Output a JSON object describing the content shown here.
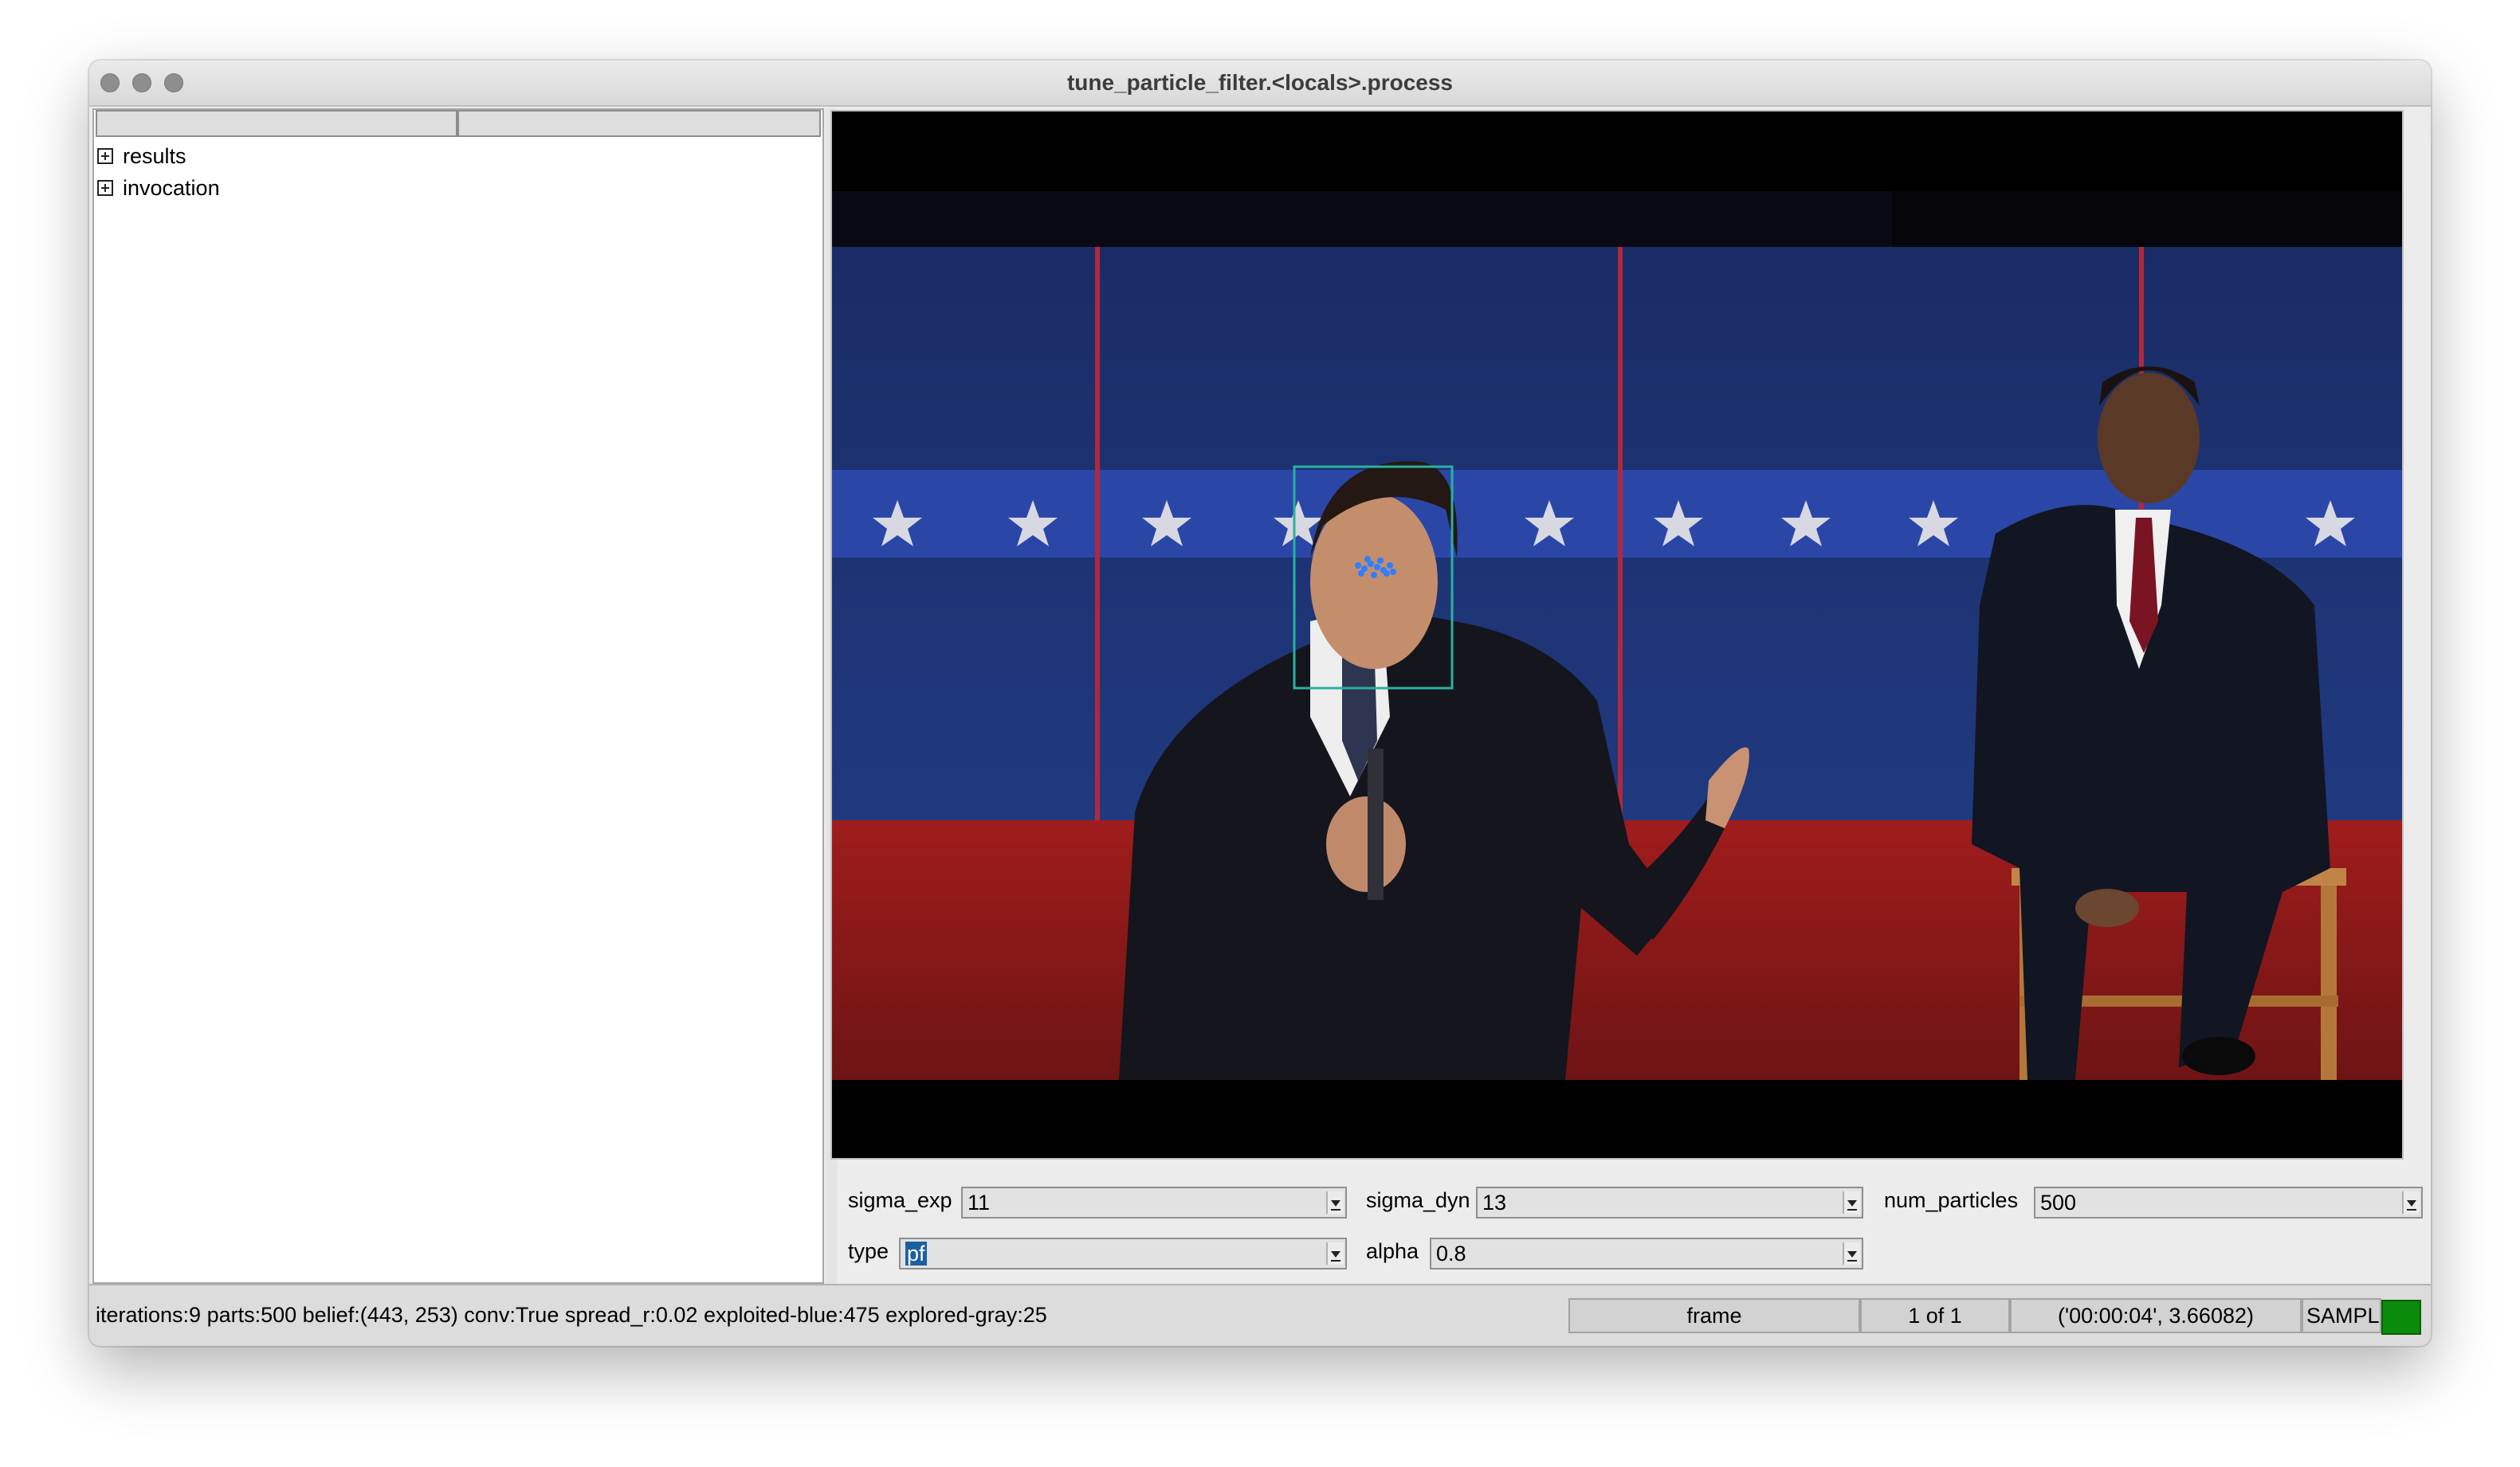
{
  "window": {
    "title": "tune_particle_filter.<locals>.process"
  },
  "tree": {
    "items": [
      {
        "label": "results"
      },
      {
        "label": "invocation"
      }
    ]
  },
  "controls": {
    "sigma_exp": {
      "label": "sigma_exp",
      "value": "11"
    },
    "sigma_dyn": {
      "label": "sigma_dyn",
      "value": "13"
    },
    "num_particles": {
      "label": "num_particles",
      "value": "500"
    },
    "type": {
      "label": "type",
      "value": "pf"
    },
    "alpha": {
      "label": "alpha",
      "value": "0.8"
    }
  },
  "status": {
    "info": "iterations:9 parts:500 belief:(443, 253) conv:True spread_r:0.02 exploited-blue:475 explored-gray:25",
    "frame_label": "frame",
    "page": "1 of 1",
    "time": "('00:00:04', 3.66082)",
    "mode": "SAMPL",
    "indicator_color": "#0b8a0b"
  },
  "colors": {
    "tracking_box": "#2bb0a0",
    "particles": "#2f7fff"
  }
}
